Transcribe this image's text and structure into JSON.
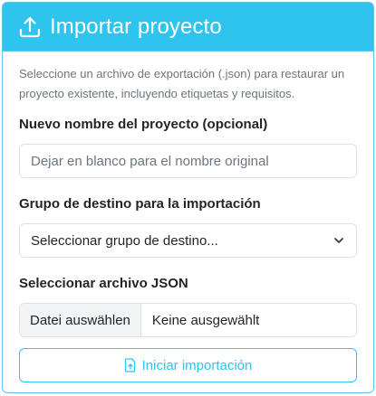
{
  "header": {
    "title": "Importar proyecto",
    "icon": "upload-icon"
  },
  "description": "Seleccione un archivo de exportación (.json) para restaurar un proyecto existente, incluyendo etiquetas y requisitos.",
  "project_name": {
    "label": "Nuevo nombre del proyecto (opcional)",
    "placeholder": "Dejar en blanco para el nombre original",
    "value": ""
  },
  "target_group": {
    "label": "Grupo de destino para la importación",
    "selected": "Seleccionar grupo de destino...",
    "icon": "chevron-down-icon"
  },
  "json_file": {
    "label": "Seleccionar archivo JSON",
    "button_label": "Datei auswählen",
    "status": "Keine ausgewählt"
  },
  "submit": {
    "label": "Iniciar importación",
    "icon": "file-arrow-up-icon"
  },
  "colors": {
    "accent": "#2ec4ee",
    "muted_text": "#6c757d",
    "border": "#dee2e6"
  }
}
